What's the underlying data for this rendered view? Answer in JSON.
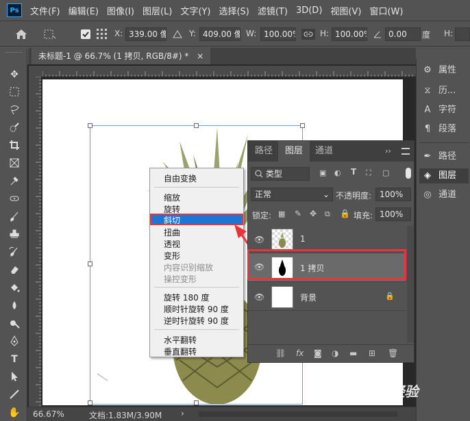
{
  "menubar": {
    "logo": "Ps",
    "items": [
      "文件(F)",
      "编辑(E)",
      "图像(I)",
      "图层(L)",
      "文字(Y)",
      "选择(S)",
      "滤镜(T)",
      "3D(D)",
      "视图(V)",
      "窗口(W)"
    ]
  },
  "options": {
    "x_label": "X:",
    "x_value": "339.00 像",
    "y_label": "Y:",
    "y_value": "409.00 像",
    "w_label": "W:",
    "w_value": "100.00%",
    "h_label": "H:",
    "h_value": "100.00%",
    "angle_value": "0.00",
    "angle_unit": "度",
    "extra_label": "H:"
  },
  "document": {
    "tab_title": "未标题-1 @ 66.7% (1 拷贝, RGB/8#) *",
    "close": "×"
  },
  "context_menu": {
    "items": [
      {
        "label": "自由变换",
        "disabled": false
      },
      {
        "label": "缩放",
        "disabled": false
      },
      {
        "label": "旋转",
        "disabled": false
      },
      {
        "label": "斜切",
        "disabled": false,
        "highlighted": true
      },
      {
        "label": "扭曲",
        "disabled": false
      },
      {
        "label": "透视",
        "disabled": false
      },
      {
        "label": "变形",
        "disabled": false
      },
      {
        "label": "内容识别缩放",
        "disabled": true
      },
      {
        "label": "操控变形",
        "disabled": true
      },
      {
        "label": "旋转 180 度",
        "disabled": false
      },
      {
        "label": "顺时针旋转 90 度",
        "disabled": false
      },
      {
        "label": "逆时针旋转 90 度",
        "disabled": false
      },
      {
        "label": "水平翻转",
        "disabled": false
      },
      {
        "label": "垂直翻转",
        "disabled": false
      }
    ]
  },
  "layers_panel": {
    "tabs": [
      "路径",
      "图层",
      "通道"
    ],
    "active_tab": "图层",
    "filter_kind": "类型",
    "blend_mode": "正常",
    "opacity_label": "不透明度:",
    "opacity_value": "100%",
    "lock_label": "锁定:",
    "fill_label": "填充:",
    "fill_value": "100%",
    "layers": [
      {
        "name": "1",
        "thumb": "pineapple",
        "visible": true,
        "selected": false,
        "locked": false
      },
      {
        "name": "1 拷贝",
        "thumb": "black-silhouette",
        "visible": true,
        "selected": true,
        "locked": false
      },
      {
        "name": "背景",
        "thumb": "white",
        "visible": true,
        "selected": false,
        "locked": true
      }
    ]
  },
  "right_panels": {
    "group1": [
      "属性",
      "历...",
      "字符",
      "段落"
    ],
    "group2": [
      "路径",
      "图层",
      "通道"
    ],
    "active": "图层"
  },
  "status": {
    "zoom": "66.67%",
    "doc_info": "文档:1.83M/3.90M",
    "arrow": "›"
  },
  "watermark": "Bai 经验",
  "colors": {
    "highlight_red": "#e8343a",
    "menu_selection_blue": "#1b76d6",
    "transform_box_blue": "#6a9bdd"
  }
}
